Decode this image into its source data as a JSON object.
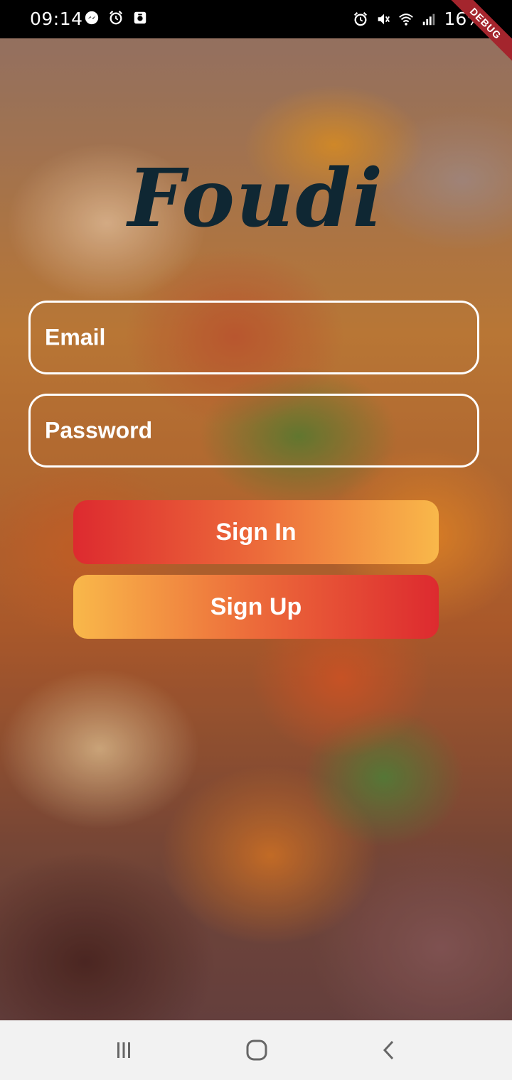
{
  "status_bar": {
    "time": "09:14",
    "battery": "16%",
    "left_icons": [
      "messenger-icon",
      "alarm-icon",
      "screenshot-icon"
    ],
    "right_icons": [
      "alarm-icon",
      "mute-icon",
      "wifi-icon",
      "signal-icon",
      "battery-icon"
    ]
  },
  "debug_banner": "DEBUG",
  "app": {
    "logo": "Foudi"
  },
  "form": {
    "email_label": "Email",
    "password_label": "Password"
  },
  "buttons": {
    "sign_in": "Sign In",
    "sign_up": "Sign Up"
  },
  "colors": {
    "logo": "#0f2733",
    "gradient_red": "#dd2a2f",
    "gradient_yellow": "#f9b84a",
    "field_border": "#ffffff"
  },
  "nav_bar": {
    "buttons": [
      "recent-apps-icon",
      "home-icon",
      "back-icon"
    ]
  }
}
